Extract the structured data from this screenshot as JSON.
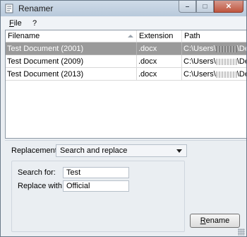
{
  "window": {
    "title": "Renamer",
    "minimize": "–",
    "maximize": "□",
    "close": "✕"
  },
  "menu": [
    {
      "accel": "F",
      "rest": "ile"
    },
    {
      "accel": "",
      "rest": "?"
    }
  ],
  "table": {
    "headers": [
      "Filename",
      "Extension",
      "Path"
    ],
    "rows": [
      {
        "filename": "Test Document (2001)",
        "extension": ".docx",
        "path_start": "C:\\Users\\",
        "path_end": "\\Deskto"
      },
      {
        "filename": "Test Document (2009)",
        "extension": ".docx",
        "path_start": "C:\\Users\\",
        "path_end": "\\Deskto"
      },
      {
        "filename": "Test Document (2013)",
        "extension": ".docx",
        "path_start": "C:\\Users\\",
        "path_end": "\\Deskto"
      }
    ]
  },
  "replacement": {
    "label": "Replacement:",
    "value": "Search and replace"
  },
  "search": {
    "label": "Search for:",
    "value": "Test"
  },
  "replace": {
    "label": "Replace with:",
    "value": "Official"
  },
  "rename_button": {
    "accel": "R",
    "rest": "ename"
  }
}
